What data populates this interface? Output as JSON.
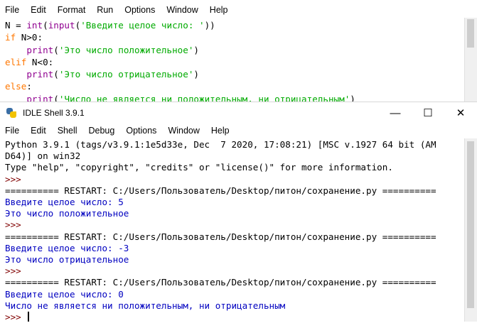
{
  "editor": {
    "menu": [
      "File",
      "Edit",
      "Format",
      "Run",
      "Options",
      "Window",
      "Help"
    ],
    "lines": {
      "l1": {
        "a": "N = ",
        "b": "int",
        "c": "(",
        "d": "input",
        "e": "(",
        "f": "'Введите целое число: '",
        "g": "))"
      },
      "l2": {
        "kw": "if",
        "rest": " N>0:"
      },
      "l3": {
        "indent": "    ",
        "fn": "print",
        "o": "(",
        "s": "'Это число положительное'",
        "c": ")"
      },
      "l4": {
        "kw": "elif",
        "rest": " N<0:"
      },
      "l5": {
        "indent": "    ",
        "fn": "print",
        "o": "(",
        "s": "'Это число отрицательное'",
        "c": ")"
      },
      "l6": {
        "kw": "else",
        "rest": ":"
      },
      "l7": {
        "indent": "    ",
        "fn": "print",
        "o": "(",
        "s": "'Число не является ни положительным, ни отрицательным'",
        "c": ")"
      }
    }
  },
  "shell": {
    "title": "IDLE Shell 3.9.1",
    "window_buttons": {
      "minimize": "—",
      "maximize": "☐",
      "close": "✕"
    },
    "menu": [
      "File",
      "Edit",
      "Shell",
      "Debug",
      "Options",
      "Window",
      "Help"
    ],
    "banner1": "Python 3.9.1 (tags/v3.9.1:1e5d33e, Dec  7 2020, 17:08:21) [MSC v.1927 64 bit (AM",
    "banner2": "D64)] on win32",
    "banner3": "Type \"help\", \"copyright\", \"credits\" or \"license()\" for more information.",
    "prompt": ">>> ",
    "restart": "========== RESTART: C:/Users/Пользователь/Desktop/питон/сохранение.py ==========",
    "runs": [
      {
        "input_line": "Введите целое число: 5",
        "output": "Это число положительное"
      },
      {
        "input_line": "Введите целое число: -3",
        "output": "Это число отрицательное"
      },
      {
        "input_line": "Введите целое число: 0",
        "output": "Число не является ни положительным, ни отрицательным"
      }
    ]
  }
}
